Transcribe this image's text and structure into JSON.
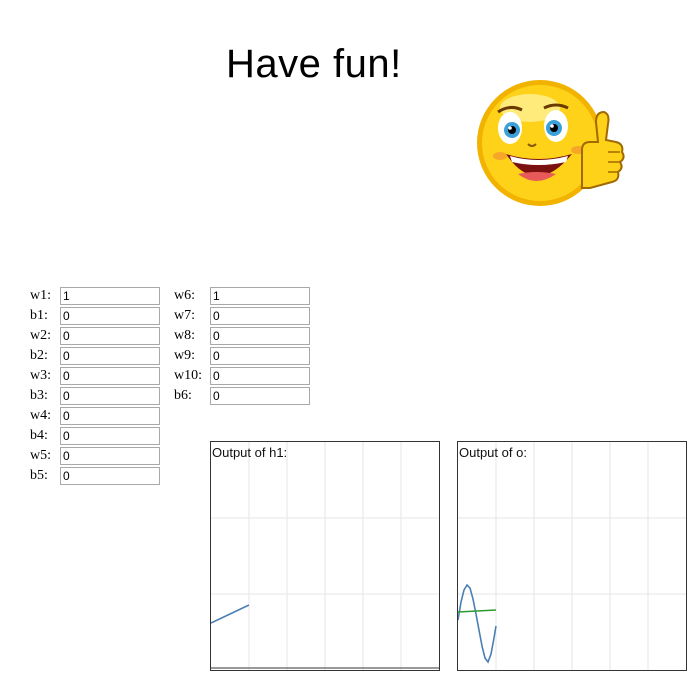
{
  "header": {
    "title": "Have fun!"
  },
  "images": {
    "mascot": "smiley-thumbs-up"
  },
  "params_left": [
    {
      "label": "w1:",
      "value": "1"
    },
    {
      "label": "b1:",
      "value": "0"
    },
    {
      "label": "w2:",
      "value": "0"
    },
    {
      "label": "b2:",
      "value": "0"
    },
    {
      "label": "w3:",
      "value": "0"
    },
    {
      "label": "b3:",
      "value": "0"
    },
    {
      "label": "w4:",
      "value": "0"
    },
    {
      "label": "b4:",
      "value": "0"
    },
    {
      "label": "w5:",
      "value": "0"
    },
    {
      "label": "b5:",
      "value": "0"
    }
  ],
  "params_right": [
    {
      "label": "w6:",
      "value": "1"
    },
    {
      "label": "w7:",
      "value": "0"
    },
    {
      "label": "w8:",
      "value": "0"
    },
    {
      "label": "w9:",
      "value": "0"
    },
    {
      "label": "w10:",
      "value": "0"
    },
    {
      "label": "b6:",
      "value": "0"
    }
  ],
  "plots": {
    "h1": {
      "label": "Output of h1:"
    },
    "o": {
      "label": "Output of o:"
    }
  },
  "colors": {
    "curve_blue": "#4a7fb5",
    "curve_green": "#2e9a2e",
    "grid": "#e6e6e6"
  }
}
